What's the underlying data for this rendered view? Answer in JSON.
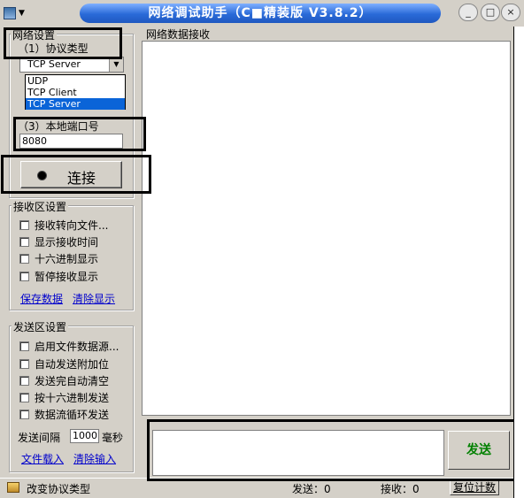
{
  "window": {
    "title": "网络调试助手（C■精装版 V3.8.2）",
    "min_label": "_",
    "max_label": "□",
    "close_label": "×"
  },
  "net_settings": {
    "group_title": "网络设置",
    "protocol_label": "（1）协议类型",
    "protocol_selected": "TCP Server",
    "protocol_options": [
      "UDP",
      "TCP Client",
      "TCP Server"
    ],
    "port_label": "（3）本地端口号",
    "port_value": "8080",
    "connect_label": "连接"
  },
  "recv_settings": {
    "group_title": "接收区设置",
    "options": [
      "接收转向文件...",
      "显示接收时间",
      "十六进制显示",
      "暂停接收显示"
    ],
    "save_link": "保存数据",
    "clear_link": "清除显示"
  },
  "send_settings": {
    "group_title": "发送区设置",
    "options": [
      "启用文件数据源...",
      "自动发送附加位",
      "发送完自动清空",
      "按十六进制发送",
      "数据流循环发送"
    ],
    "interval_label": "发送间隔",
    "interval_value": "1000",
    "interval_unit": "毫秒",
    "load_link": "文件载入",
    "clear_link": "清除输入"
  },
  "recv_area": {
    "title": "网络数据接收"
  },
  "send_button": "发送",
  "status": {
    "message": "改变协议类型",
    "send_count": "发送：0",
    "recv_count": "接收：0",
    "reset_label": "复位计数"
  }
}
